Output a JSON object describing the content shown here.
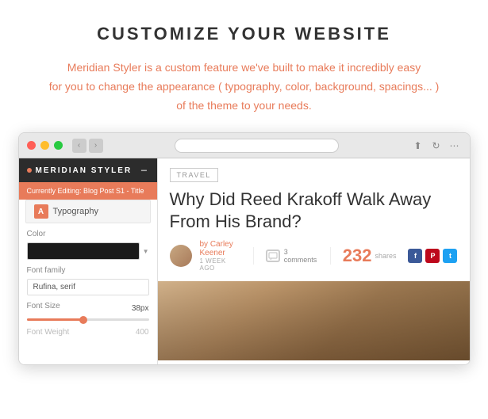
{
  "page": {
    "title": "CUSTOMIZE YOUR WEBSITE",
    "description_line1": "Meridian Styler is a custom feature we've built to make it incredibly easy",
    "description_line2": "for you to change the appearance ( typography, color, background, spacings... )",
    "description_line3": "of the theme to your needs."
  },
  "browser": {
    "nav_back": "‹",
    "nav_forward": "›"
  },
  "styler": {
    "header_title": "MERIDIAN STYLER",
    "currently_editing": "Currently Editing: Blog Post S1 - Title",
    "typography_label": "Typography",
    "typography_icon": "A",
    "color_label": "Color",
    "font_family_label": "Font family",
    "font_family_value": "Rufina, serif",
    "font_size_label": "Font Size",
    "font_size_value": "38px",
    "font_weight_label": "Font Weight",
    "font_weight_value": "400"
  },
  "blog": {
    "travel_tag": "TRAVEL",
    "title": "Why Did Reed Krakoff Walk Away From His Brand?",
    "author_name": "by Carley Keener",
    "post_date": "1 WEEK AGO",
    "comments_count": "3 comments",
    "shares_number": "232",
    "shares_label": "shares"
  }
}
